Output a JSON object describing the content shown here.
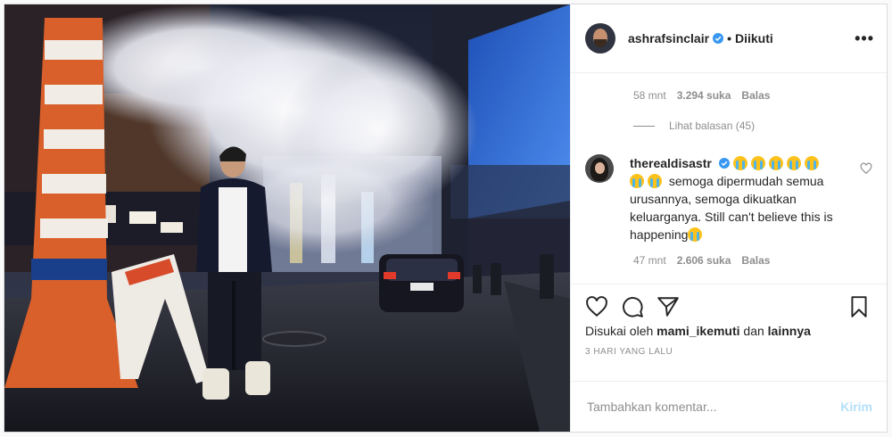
{
  "header": {
    "username": "ashrafsinclair",
    "separator": "•",
    "follow_status": "Diikuti",
    "more_icon": "more-horizontal-icon"
  },
  "first_comment_meta": {
    "time": "58 mnt",
    "likes": "3.294 suka",
    "reply": "Balas"
  },
  "view_replies": "Lihat balasan (45)",
  "comment": {
    "username": "therealdisastr",
    "text": "semoga dipermudah semua urusannya, semoga dikuatkan keluarganya. Still can't believe this is happening",
    "time": "47 mnt",
    "likes": "2.606 suka",
    "reply": "Balas"
  },
  "likes": {
    "prefix": "Disukai oleh",
    "user": "mami_ikemuti",
    "conj": "dan",
    "others": "lainnya"
  },
  "posted": "3 HARI YANG LALU",
  "add_comment": {
    "placeholder": "Tambahkan komentar...",
    "post_label": "Kirim"
  },
  "colors": {
    "verified": "#3897f0",
    "post_button": "#b2dffc",
    "secondary_text": "#8e8e8e"
  }
}
